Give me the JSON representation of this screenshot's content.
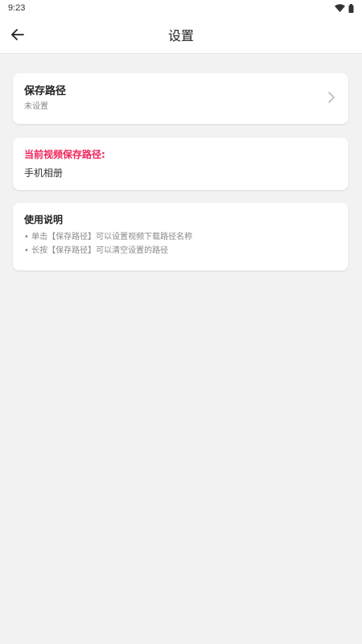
{
  "status_bar": {
    "time": "9:23",
    "icons": [
      "wifi-icon",
      "battery-icon"
    ]
  },
  "header": {
    "title": "设置",
    "back_icon": "arrow-left-icon"
  },
  "save_path": {
    "title": "保存路径",
    "value": "未设置",
    "chevron_icon": "chevron-right-icon"
  },
  "current_path": {
    "label": "当前视频保存路径:",
    "value": "手机相册"
  },
  "instructions": {
    "title": "使用说明",
    "items": [
      "• 单击【保存路径】可以设置视频下载路径名称",
      "• 长按【保存路径】可以清空设置的路径"
    ]
  },
  "colors": {
    "accent": "#f0245a",
    "background": "#f2f2f2",
    "card": "#ffffff",
    "muted_text": "#888888"
  }
}
